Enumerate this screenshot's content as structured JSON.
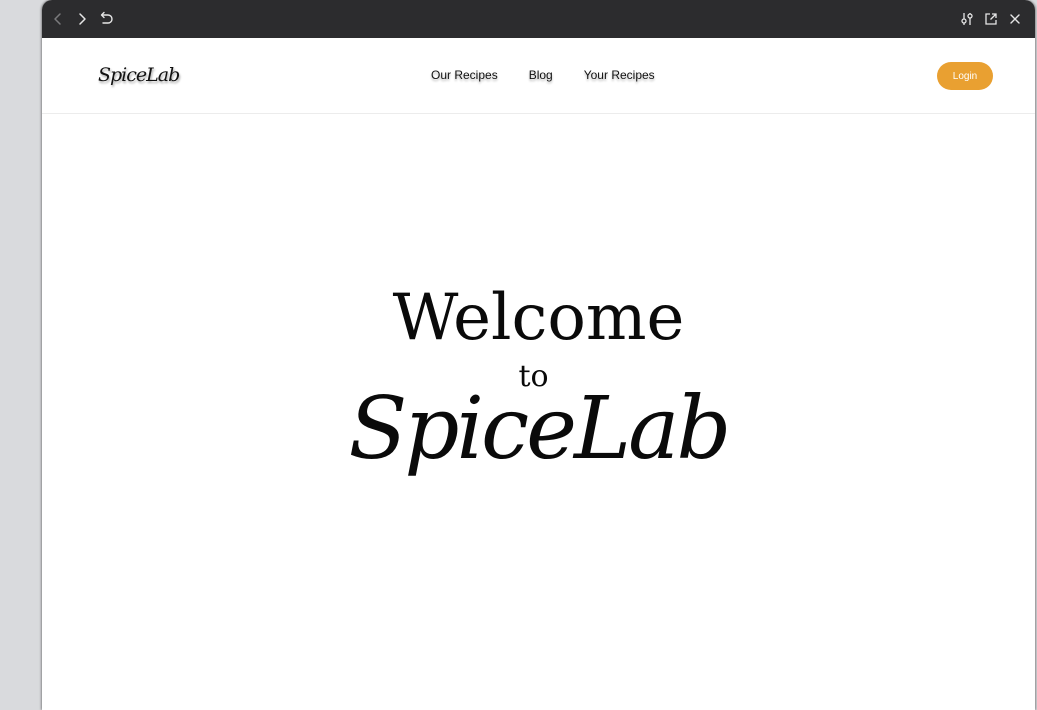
{
  "browser": {
    "toolbar": {
      "back_icon": "chevron-left-icon",
      "forward_icon": "chevron-right-icon",
      "reload_icon": "undo-arrow-icon",
      "settings_icon": "sliders-icon",
      "open_external_icon": "external-link-icon",
      "close_icon": "close-icon"
    },
    "colors": {
      "toolbar_bg": "#2c2c2e",
      "toolbar_icon": "#e6e6e6",
      "toolbar_icon_disabled": "#7a7a7c"
    }
  },
  "site": {
    "logo": "SpiceLab",
    "nav": [
      {
        "label": "Our Recipes"
      },
      {
        "label": "Blog"
      },
      {
        "label": "Your Recipes"
      }
    ],
    "login_label": "Login",
    "colors": {
      "accent": "#e9a031",
      "text": "#0a0a0a"
    }
  },
  "hero": {
    "welcome": "Welcome",
    "to": "to",
    "brand": "SpiceLab"
  }
}
